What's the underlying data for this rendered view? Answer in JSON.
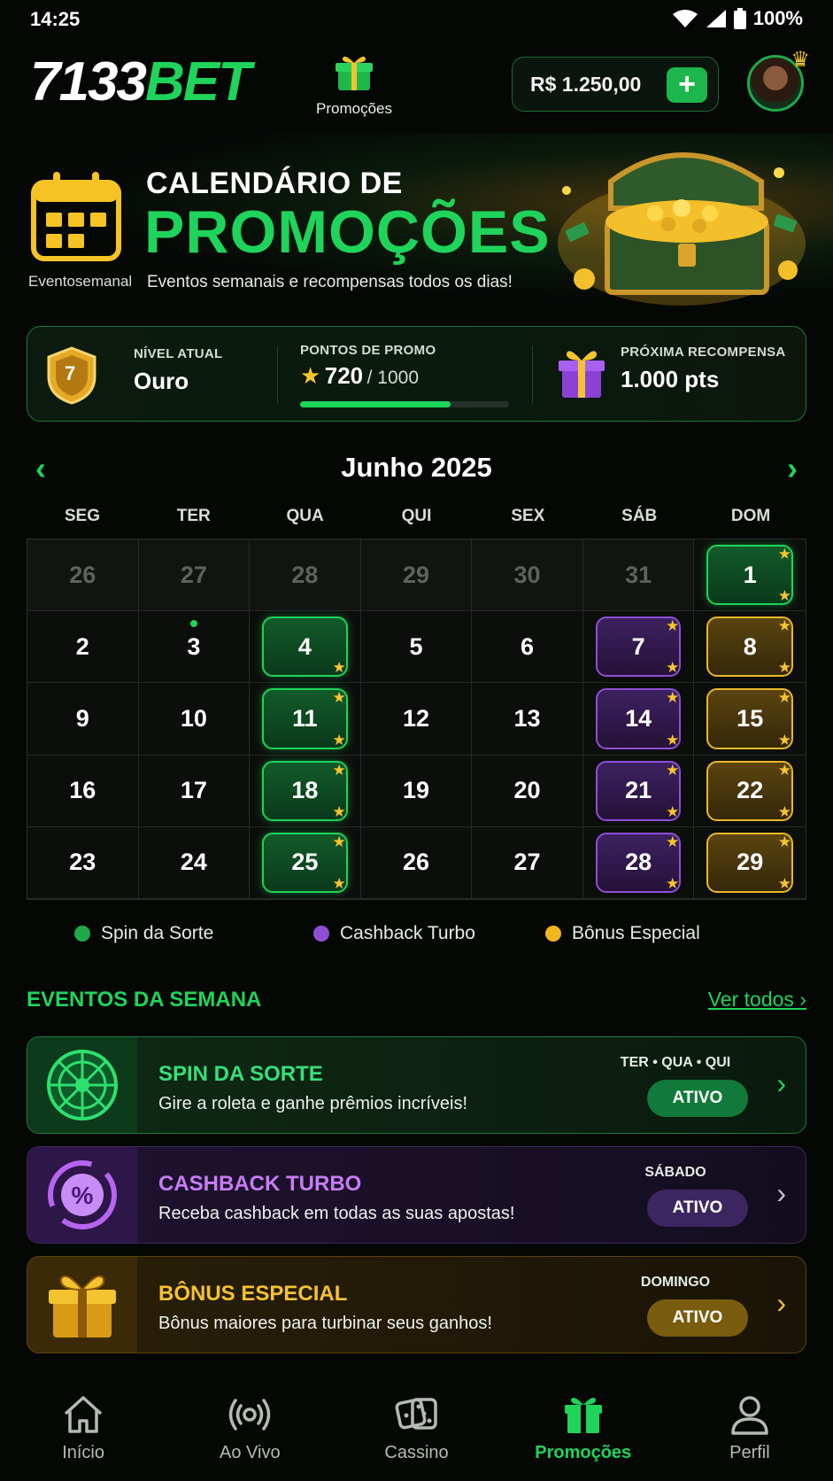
{
  "status": {
    "time": "14:25",
    "battery": "100%"
  },
  "header": {
    "logo_white": "7133",
    "logo_green": "BET",
    "promo_label": "Promoções",
    "balance": "R$ 1.250,00",
    "add_label": "+"
  },
  "hero": {
    "icon_label": "Eventosemanal",
    "title_line1": "CALENDÁRIO DE",
    "title_line2": "PROMOÇÕES",
    "subtitle": "Eventos semanais e recompensas todos os dias!"
  },
  "stats": {
    "level_label": "NÍVEL ATUAL",
    "level_value": "Ouro",
    "level_number": "7",
    "points_label": "PONTOS DE PROMO",
    "points_current": "720",
    "points_total": "/ 1000",
    "points_progress": 0.72,
    "reward_label": "PRÓXIMA RECOMPENSA",
    "reward_value": "1.000 pts"
  },
  "calendar": {
    "month": "Junho 2025",
    "weekdays": [
      "SEG",
      "TER",
      "QUA",
      "QUI",
      "SEX",
      "SÁB",
      "DOM"
    ],
    "days": [
      {
        "n": "26",
        "dim": true
      },
      {
        "n": "27",
        "dim": true
      },
      {
        "n": "28",
        "dim": true
      },
      {
        "n": "29",
        "dim": true
      },
      {
        "n": "30",
        "dim": true
      },
      {
        "n": "31",
        "dim": true
      },
      {
        "n": "1",
        "type": "green",
        "stars": "both"
      },
      {
        "n": "2"
      },
      {
        "n": "3",
        "dot": true
      },
      {
        "n": "4",
        "type": "green",
        "stars": "br"
      },
      {
        "n": "5"
      },
      {
        "n": "6"
      },
      {
        "n": "7",
        "type": "purple",
        "stars": "both"
      },
      {
        "n": "8",
        "type": "gold",
        "stars": "both"
      },
      {
        "n": "9"
      },
      {
        "n": "10"
      },
      {
        "n": "11",
        "type": "green",
        "stars": "both"
      },
      {
        "n": "12"
      },
      {
        "n": "13"
      },
      {
        "n": "14",
        "type": "purple",
        "stars": "both"
      },
      {
        "n": "15",
        "type": "gold",
        "stars": "both"
      },
      {
        "n": "16"
      },
      {
        "n": "17"
      },
      {
        "n": "18",
        "type": "green",
        "stars": "both"
      },
      {
        "n": "19"
      },
      {
        "n": "20"
      },
      {
        "n": "21",
        "type": "purple",
        "stars": "both"
      },
      {
        "n": "22",
        "type": "gold",
        "stars": "both"
      },
      {
        "n": "23"
      },
      {
        "n": "24"
      },
      {
        "n": "25",
        "type": "green",
        "stars": "both"
      },
      {
        "n": "26"
      },
      {
        "n": "27"
      },
      {
        "n": "28",
        "type": "purple",
        "stars": "both"
      },
      {
        "n": "29",
        "type": "gold",
        "stars": "both"
      }
    ],
    "star_glyph": "★"
  },
  "legend": [
    {
      "label": "Spin da Sorte",
      "color": "#1fa84a"
    },
    {
      "label": "Cashback Turbo",
      "color": "#8e4fd6"
    },
    {
      "label": "Bônus Especial",
      "color": "#f1b520"
    }
  ],
  "events": {
    "title": "EVENTOS DA SEMANA",
    "see_all": "Ver todos",
    "items": [
      {
        "name": "SPIN DA SORTE",
        "desc": "Gire a roleta e ganhe prêmios incríveis!",
        "days": "TER • QUA • QUI",
        "badge": "ATIVO"
      },
      {
        "name": "CASHBACK TURBO",
        "desc": "Receba cashback em todas as suas apostas!",
        "days": "SÁBADO",
        "badge": "ATIVO"
      },
      {
        "name": "BÔNUS ESPECIAL",
        "desc": "Bônus maiores para turbinar seus ganhos!",
        "days": "DOMINGO",
        "badge": "ATIVO"
      }
    ]
  },
  "nav": [
    {
      "label": "Início",
      "icon": "home-icon"
    },
    {
      "label": "Ao Vivo",
      "icon": "live-icon"
    },
    {
      "label": "Cassino",
      "icon": "dice-icon"
    },
    {
      "label": "Promoções",
      "icon": "gift-icon",
      "active": true
    },
    {
      "label": "Perfil",
      "icon": "user-icon"
    }
  ]
}
